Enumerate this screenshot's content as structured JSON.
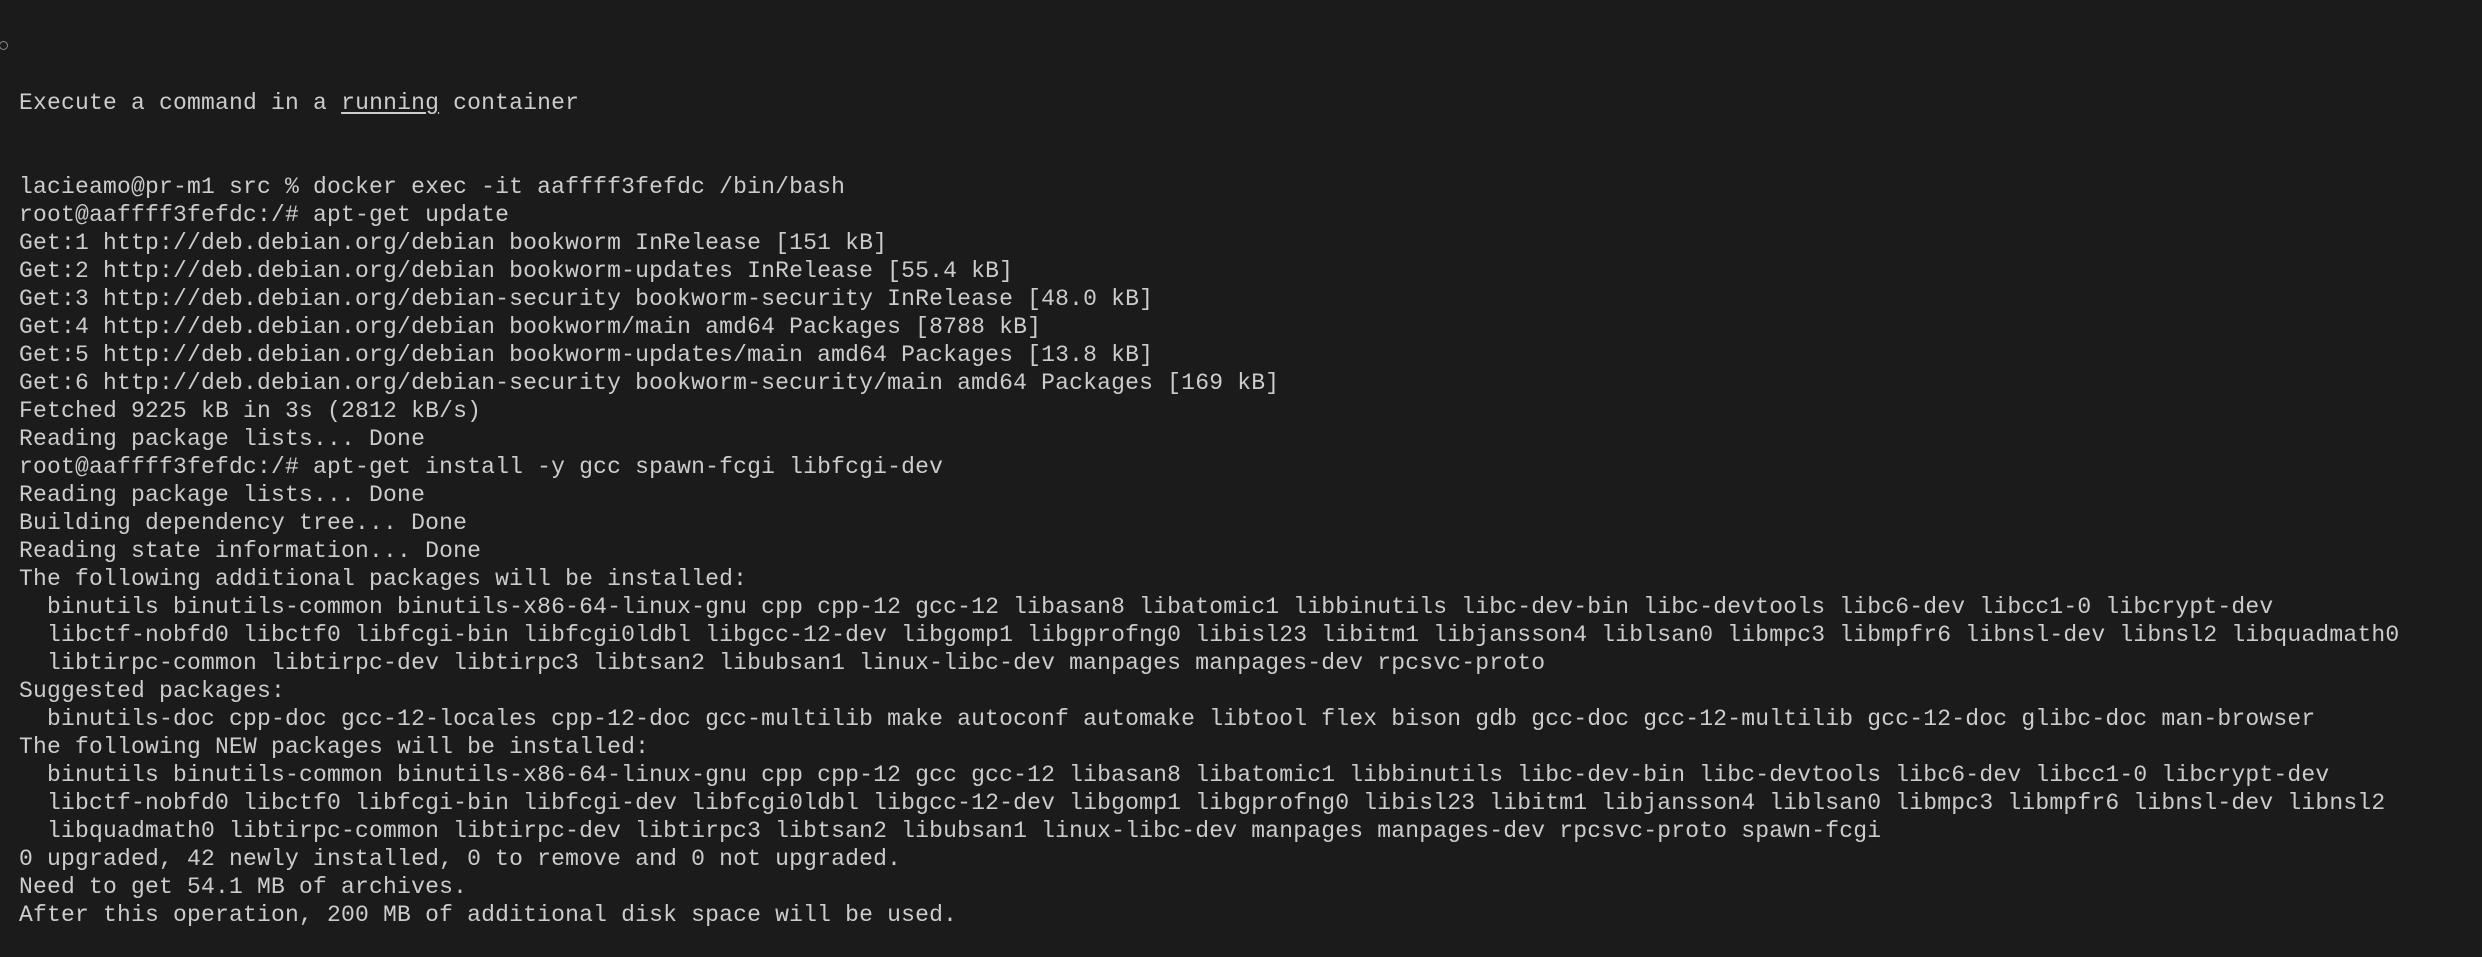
{
  "terminal": {
    "hint": {
      "prefix": "Execute a command in a ",
      "link": "running",
      "suffix": " container"
    },
    "lines": [
      "lacieamo@pr-m1 src % docker exec -it aaffff3fefdc /bin/bash",
      "root@aaffff3fefdc:/# apt-get update",
      "Get:1 http://deb.debian.org/debian bookworm InRelease [151 kB]",
      "Get:2 http://deb.debian.org/debian bookworm-updates InRelease [55.4 kB]",
      "Get:3 http://deb.debian.org/debian-security bookworm-security InRelease [48.0 kB]",
      "Get:4 http://deb.debian.org/debian bookworm/main amd64 Packages [8788 kB]",
      "Get:5 http://deb.debian.org/debian bookworm-updates/main amd64 Packages [13.8 kB]",
      "Get:6 http://deb.debian.org/debian-security bookworm-security/main amd64 Packages [169 kB]",
      "Fetched 9225 kB in 3s (2812 kB/s)",
      "Reading package lists... Done",
      "root@aaffff3fefdc:/# apt-get install -y gcc spawn-fcgi libfcgi-dev",
      "Reading package lists... Done",
      "Building dependency tree... Done",
      "Reading state information... Done",
      "The following additional packages will be installed:",
      "  binutils binutils-common binutils-x86-64-linux-gnu cpp cpp-12 gcc-12 libasan8 libatomic1 libbinutils libc-dev-bin libc-devtools libc6-dev libcc1-0 libcrypt-dev",
      "  libctf-nobfd0 libctf0 libfcgi-bin libfcgi0ldbl libgcc-12-dev libgomp1 libgprofng0 libisl23 libitm1 libjansson4 liblsan0 libmpc3 libmpfr6 libnsl-dev libnsl2 libquadmath0",
      "  libtirpc-common libtirpc-dev libtirpc3 libtsan2 libubsan1 linux-libc-dev manpages manpages-dev rpcsvc-proto",
      "Suggested packages:",
      "  binutils-doc cpp-doc gcc-12-locales cpp-12-doc gcc-multilib make autoconf automake libtool flex bison gdb gcc-doc gcc-12-multilib gcc-12-doc glibc-doc man-browser",
      "The following NEW packages will be installed:",
      "  binutils binutils-common binutils-x86-64-linux-gnu cpp cpp-12 gcc gcc-12 libasan8 libatomic1 libbinutils libc-dev-bin libc-devtools libc6-dev libcc1-0 libcrypt-dev",
      "  libctf-nobfd0 libctf0 libfcgi-bin libfcgi-dev libfcgi0ldbl libgcc-12-dev libgomp1 libgprofng0 libisl23 libitm1 libjansson4 liblsan0 libmpc3 libmpfr6 libnsl-dev libnsl2",
      "  libquadmath0 libtirpc-common libtirpc-dev libtirpc3 libtsan2 libubsan1 linux-libc-dev manpages manpages-dev rpcsvc-proto spawn-fcgi",
      "0 upgraded, 42 newly installed, 0 to remove and 0 not upgraded.",
      "Need to get 54.1 MB of archives.",
      "After this operation, 200 MB of additional disk space will be used."
    ]
  }
}
